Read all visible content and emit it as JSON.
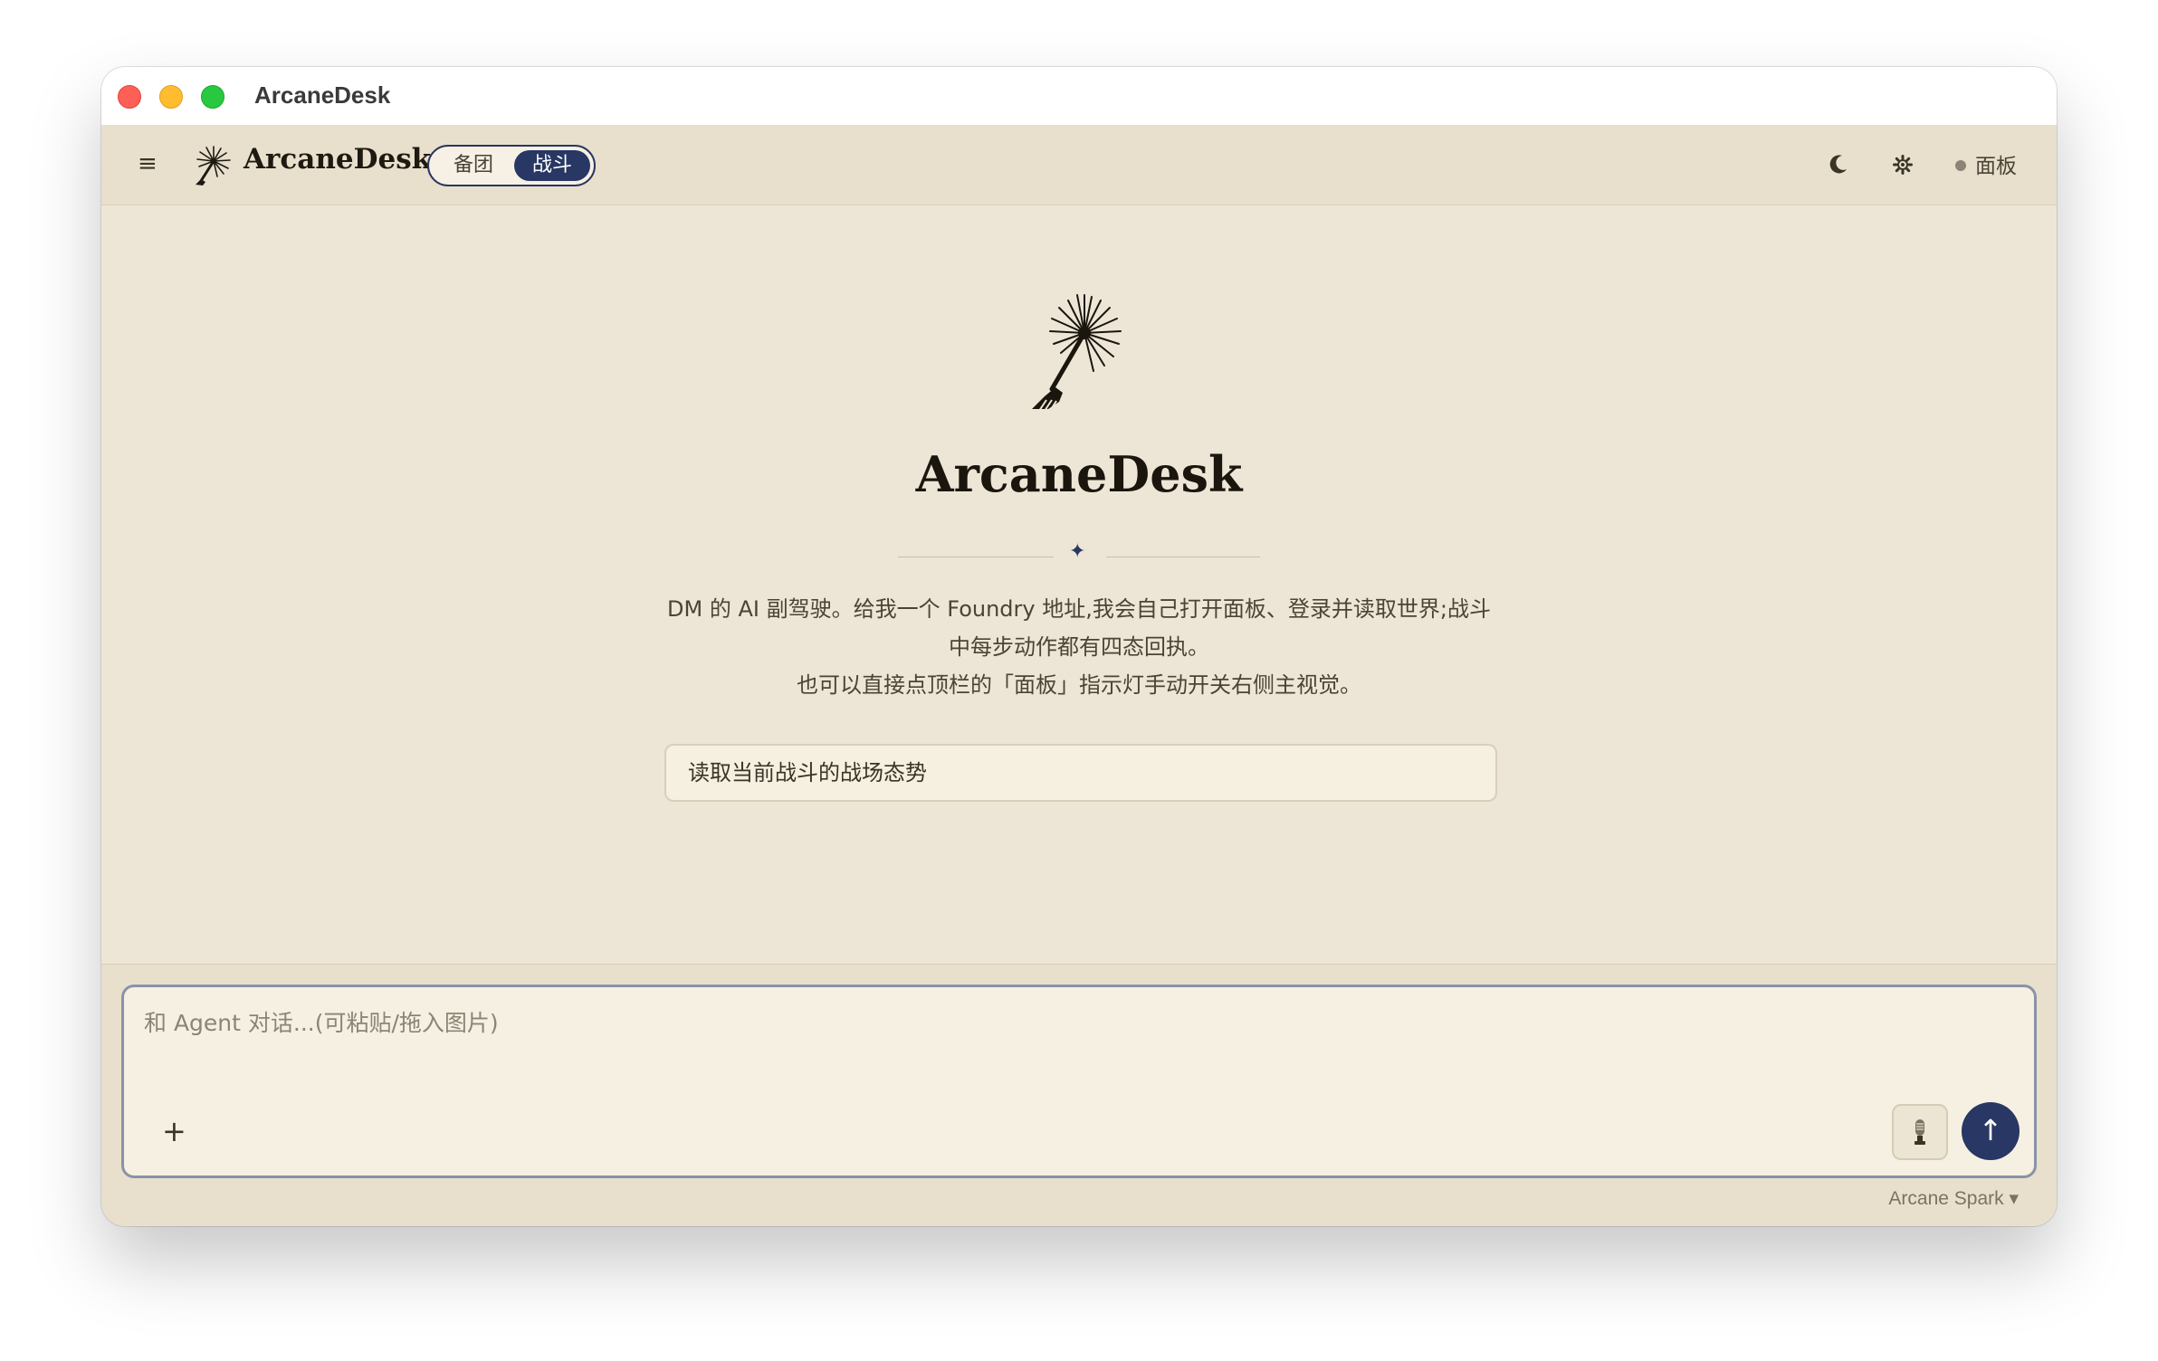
{
  "window": {
    "title": "ArcaneDesk"
  },
  "appbar": {
    "menu_icon": "≡",
    "brand": "ArcaneDesk",
    "mode_options": [
      "备团",
      "战斗"
    ],
    "active_mode": "战斗",
    "theme_icon": "moon-icon",
    "settings_icon": "gear-icon",
    "panel_label": "面板"
  },
  "hero": {
    "title": "ArcaneDesk",
    "description_line1": "DM 的 AI 副驾驶。给我一个 Foundry 地址,我会自己打开面板、登录并读取世界;战斗中每步动作都有四态回执。",
    "description_line2": "也可以直接点顶栏的「面板」指示灯手动开关右侧主视觉。",
    "suggestion": "读取当前战斗的战场态势"
  },
  "composer": {
    "placeholder": "和 Agent 对话...(可粘贴/拖入图片)",
    "attach_label": "+",
    "send_label": "↑",
    "model": "Arcane Spark ▾"
  },
  "colors": {
    "accent": "#283763",
    "background": "#ede6d6",
    "appbar": "#e8e0cd"
  }
}
